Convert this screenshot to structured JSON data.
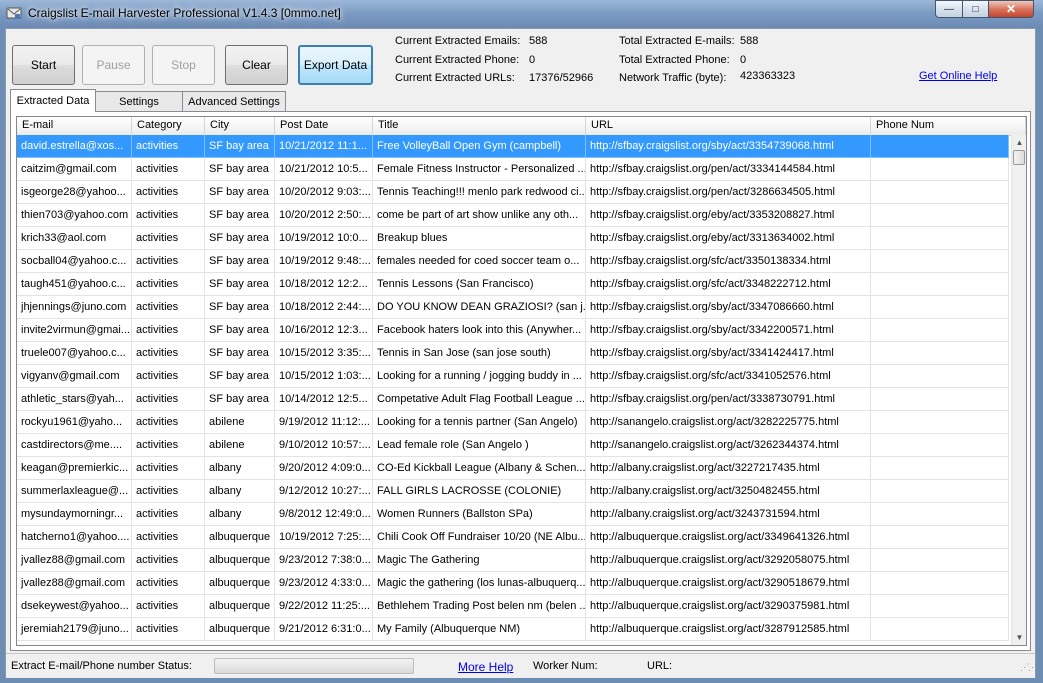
{
  "window": {
    "title": "Craigslist E-mail Harvester Professional V1.4.3 [0mmo.net]",
    "minimize": "—",
    "maximize": "□",
    "close": "✕"
  },
  "toolbar": {
    "start": "Start",
    "pause": "Pause",
    "stop": "Stop",
    "clear": "Clear",
    "export": "Export Data"
  },
  "stats": {
    "current_emails_label": "Current Extracted Emails:",
    "current_emails_value": "588",
    "current_phone_label": "Current Extracted Phone:",
    "current_phone_value": "0",
    "current_urls_label": "Current Extracted URLs:",
    "current_urls_value": "17376/52966",
    "total_emails_label": "Total Extracted E-mails:",
    "total_emails_value": "588",
    "total_phone_label": "Total Extracted Phone:",
    "total_phone_value": "0",
    "traffic_label": "Network Traffic (byte):",
    "traffic_value": "423363323",
    "get_help": "Get Online Help"
  },
  "tabs": [
    {
      "label": "Extracted Data",
      "active": true
    },
    {
      "label": "Settings",
      "active": false
    },
    {
      "label": "Advanced Settings",
      "active": false
    }
  ],
  "grid": {
    "columns": [
      "E-mail",
      "Category",
      "City",
      "Post Date",
      "Title",
      "URL",
      "Phone Num"
    ],
    "rows": [
      [
        "david.estrella@xos...",
        "activities",
        "SF bay area",
        "10/21/2012 11:1...",
        " Free VolleyBall Open Gym (campbell)",
        "http://sfbay.craigslist.org/sby/act/3354739068.html",
        ""
      ],
      [
        "caitzim@gmail.com",
        "activities",
        "SF bay area",
        "10/21/2012 10:5...",
        "Female Fitness Instructor - Personalized ...",
        "http://sfbay.craigslist.org/pen/act/3334144584.html",
        ""
      ],
      [
        "isgeorge28@yahoo...",
        "activities",
        "SF bay area",
        "10/20/2012 9:03:...",
        "Tennis Teaching!!! menlo park redwood ci...",
        "http://sfbay.craigslist.org/pen/act/3286634505.html",
        ""
      ],
      [
        "thien703@yahoo.com",
        "activities",
        "SF bay area",
        "10/20/2012 2:50:...",
        "come be part of art show unlike any oth...",
        "http://sfbay.craigslist.org/eby/act/3353208827.html",
        ""
      ],
      [
        "krich33@aol.com",
        "activities",
        "SF bay area",
        "10/19/2012 10:0...",
        "Breakup blues",
        "http://sfbay.craigslist.org/eby/act/3313634002.html",
        ""
      ],
      [
        "socball04@yahoo.c...",
        "activities",
        "SF bay area",
        "10/19/2012 9:48:...",
        "females needed for coed soccer team o...",
        "http://sfbay.craigslist.org/sfc/act/3350138334.html",
        ""
      ],
      [
        "taugh451@yahoo.c...",
        "activities",
        "SF bay area",
        "10/18/2012 12:2...",
        "Tennis Lessons (San Francisco)",
        "http://sfbay.craigslist.org/sfc/act/3348222712.html",
        ""
      ],
      [
        "jhjennings@juno.com",
        "activities",
        "SF bay area",
        "10/18/2012 2:44:...",
        "DO YOU KNOW DEAN GRAZIOSI? (san j...",
        "http://sfbay.craigslist.org/sby/act/3347086660.html",
        ""
      ],
      [
        "invite2virmun@gmai...",
        "activities",
        "SF bay area",
        "10/16/2012 12:3...",
        "Facebook haters look into this (Anywher...",
        "http://sfbay.craigslist.org/sby/act/3342200571.html",
        ""
      ],
      [
        "truele007@yahoo.c...",
        "activities",
        "SF bay area",
        "10/15/2012 3:35:...",
        "Tennis in San Jose (san jose south)",
        "http://sfbay.craigslist.org/sby/act/3341424417.html",
        ""
      ],
      [
        "vigyanv@gmail.com",
        "activities",
        "SF bay area",
        "10/15/2012 1:03:...",
        "Looking for a running / jogging buddy in ...",
        "http://sfbay.craigslist.org/sfc/act/3341052576.html",
        ""
      ],
      [
        "athletic_stars@yah...",
        "activities",
        "SF bay area",
        "10/14/2012 12:5...",
        "Competative Adult Flag Football League ...",
        "http://sfbay.craigslist.org/pen/act/3338730791.html",
        ""
      ],
      [
        "rockyu1961@yaho...",
        "activities",
        "abilene",
        "9/19/2012 11:12:...",
        "Looking for a tennis partner (San Angelo)",
        "http://sanangelo.craigslist.org/act/3282225775.html",
        ""
      ],
      [
        "castdirectors@me....",
        "activities",
        "abilene",
        "9/10/2012 10:57:...",
        "Lead female role (San Angelo )",
        "http://sanangelo.craigslist.org/act/3262344374.html",
        ""
      ],
      [
        "keagan@premierkic...",
        "activities",
        "albany",
        "9/20/2012 4:09:0...",
        "CO-Ed Kickball League (Albany & Schen...",
        "http://albany.craigslist.org/act/3227217435.html",
        ""
      ],
      [
        "summerlaxleague@...",
        "activities",
        "albany",
        "9/12/2012 10:27:...",
        "FALL GIRLS LACROSSE (COLONIE)",
        "http://albany.craigslist.org/act/3250482455.html",
        ""
      ],
      [
        "mysundaymorningr...",
        "activities",
        "albany",
        "9/8/2012 12:49:0...",
        "Women Runners  (Ballston SPa)",
        "http://albany.craigslist.org/act/3243731594.html",
        ""
      ],
      [
        "hatcherno1@yahoo....",
        "activities",
        "albuquerque",
        "10/19/2012 7:25:...",
        "Chili Cook Off Fundraiser 10/20 (NE Albu...",
        "http://albuquerque.craigslist.org/act/3349641326.html",
        ""
      ],
      [
        "jvallez88@gmail.com",
        "activities",
        "albuquerque",
        "9/23/2012 7:38:0...",
        "Magic The Gathering",
        "http://albuquerque.craigslist.org/act/3292058075.html",
        ""
      ],
      [
        "jvallez88@gmail.com",
        "activities",
        "albuquerque",
        "9/23/2012 4:33:0...",
        "Magic the gathering (los lunas-albuquerq...",
        "http://albuquerque.craigslist.org/act/3290518679.html",
        ""
      ],
      [
        "dsekeywest@yahoo...",
        "activities",
        "albuquerque",
        "9/22/2012 11:25:...",
        "Bethlehem Trading Post belen nm (belen ...",
        "http://albuquerque.craigslist.org/act/3290375981.html",
        ""
      ],
      [
        "jeremiah2179@juno...",
        "activities",
        "albuquerque",
        "9/21/2012 6:31:0...",
        "My Family  (Albuquerque NM)",
        "http://albuquerque.craigslist.org/act/3287912585.html",
        ""
      ]
    ]
  },
  "status": {
    "label": "Extract E-mail/Phone number Status:",
    "more_help": "More Help",
    "worker": "Worker Num:",
    "url": "URL:"
  },
  "colors": {
    "selected_row": "#3399ff",
    "link": "#0000ee",
    "export_border": "#3c7fb1"
  }
}
